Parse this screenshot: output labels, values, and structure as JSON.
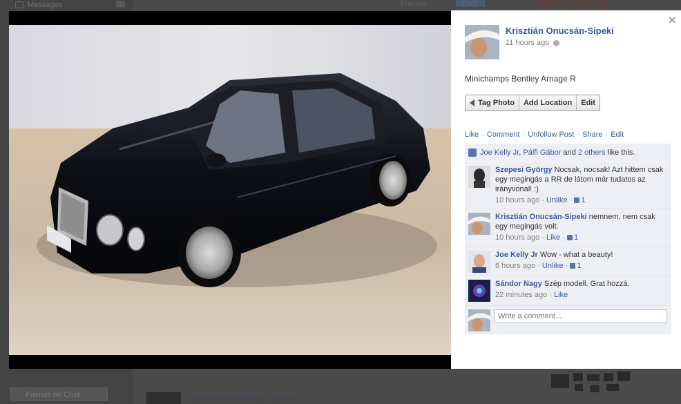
{
  "background": {
    "messages_label": "Messages",
    "messages_count": "1",
    "friends_label": "Friends",
    "post_label": "Post",
    "profile_name": "Pinaman Bronx Pan",
    "chat_label": "Friends on Chat",
    "story_actor": "Szentendre Festők Városa",
    "story_verb": "shared",
    "story_object": "Szentendre Város Hivatásos"
  },
  "viewer": {
    "close_label": "×",
    "author": "Krisztián Onucsán-Sipeki",
    "time": "11 hours ago",
    "caption": "Minichamps Bentley Arnage R",
    "buttons": {
      "tag": "Tag Photo",
      "location": "Add Location",
      "edit": "Edit"
    },
    "actions": [
      "Like",
      "Comment",
      "Unfollow Post",
      "Share",
      "Edit"
    ],
    "likes": {
      "name1": "Joe Kelly Jr",
      "comma": ",",
      "name2": "Pálfi Gábor",
      "and": "and",
      "others": "2 others",
      "suffix": "like this."
    },
    "comments": [
      {
        "name": "Szepesi György",
        "text": "Nocsak, nocsak! Azt hittem csak egy megingás a RR de látom már tudatos az irányvonal! :)",
        "time": "10 hours ago",
        "action": "Unlike",
        "likes": "1"
      },
      {
        "name": "Krisztián Onucsán-Sipeki",
        "text": "nemnem, nem csak egy megingás volt.",
        "time": "10 hours ago",
        "action": "Like",
        "likes": "1"
      },
      {
        "name": "Joe Kelly Jr",
        "text": "Wow - what a beauty!",
        "time": "6 hours ago",
        "action": "Unlike",
        "likes": "1"
      },
      {
        "name": "Sándor Nagy",
        "text": "Szép modell. Grat hozzá.",
        "time": "22 minutes ago",
        "action": "Like",
        "likes": ""
      }
    ],
    "write_placeholder": "Write a comment..."
  }
}
